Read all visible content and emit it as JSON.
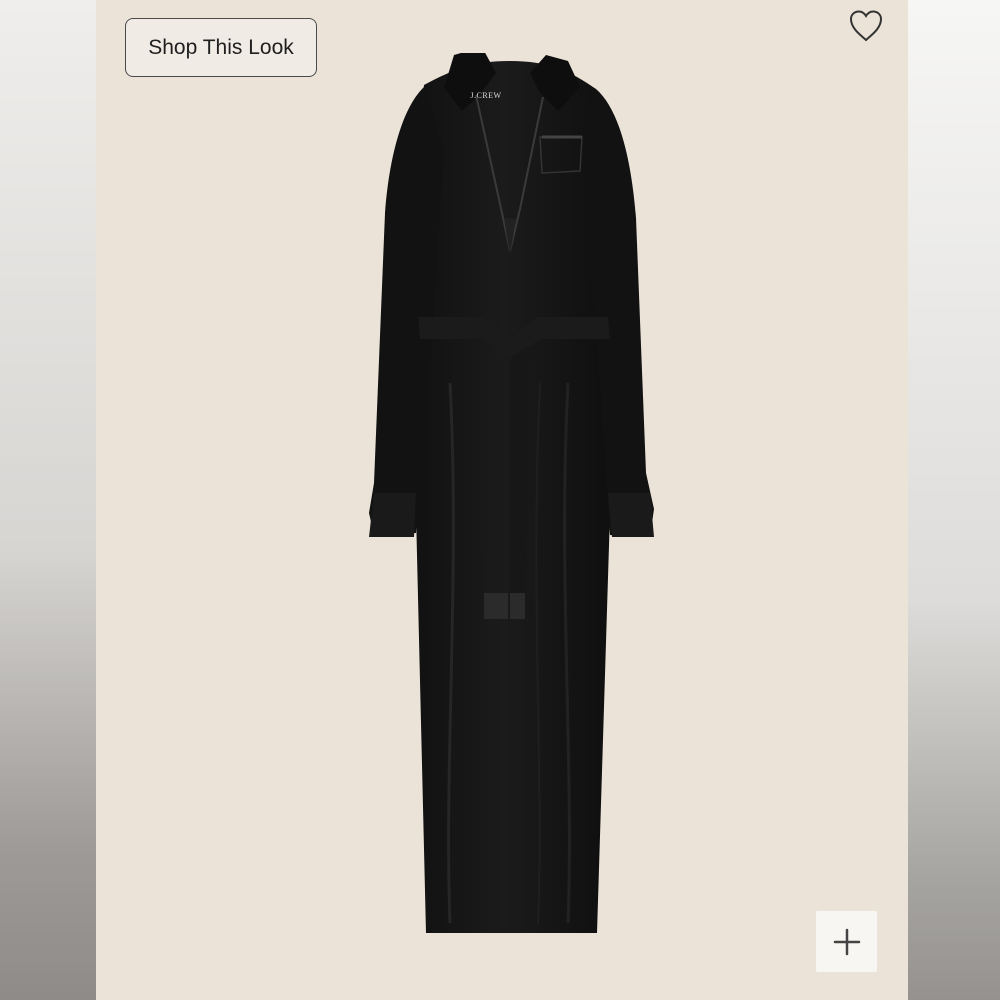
{
  "page": {
    "shop_look_label": "Shop This Look",
    "brand_label": "J.CREW",
    "heart_icon": "heart-outline-icon",
    "add_icon": "plus-icon",
    "colors": {
      "panel_background": "#ebe3d8",
      "dress": "#151515",
      "button_border": "#4a4a4a"
    }
  }
}
